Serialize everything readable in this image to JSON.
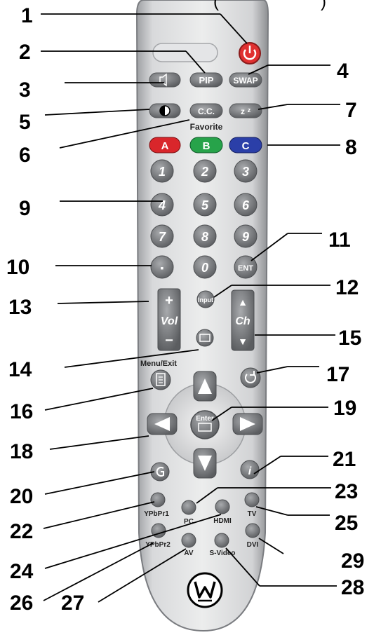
{
  "header_fragment": "(",
  "header_fragment_right": ")",
  "callouts": [
    "1",
    "2",
    "3",
    "4",
    "5",
    "6",
    "7",
    "8",
    "9",
    "10",
    "11",
    "12",
    "13",
    "14",
    "15",
    "16",
    "17",
    "18",
    "19",
    "20",
    "21",
    "22",
    "23",
    "24",
    "25",
    "26",
    "27",
    "28",
    "29"
  ],
  "buttons": {
    "pip": "PIP",
    "swap": "SWAP",
    "cc": "C.C.",
    "sleep": "z",
    "favorite": "Favorite",
    "a": "A",
    "b": "B",
    "c": "C",
    "digits": [
      "1",
      "2",
      "3",
      "4",
      "5",
      "6",
      "7",
      "8",
      "9",
      "0"
    ],
    "dot": "▪",
    "ent": "ENT",
    "input": "Input",
    "vol_plus": "+",
    "vol": "Vol",
    "vol_minus": "−",
    "ch_up": "▲",
    "ch": "Ch",
    "ch_down": "▼",
    "menu_exit": "Menu/Exit",
    "enter": "Enter",
    "ypbpr1": "YPbPr1",
    "pc": "PC",
    "hdmi": "HDMI",
    "tv": "TV",
    "ypbpr2": "YPbPr2",
    "av": "AV",
    "svideo": "S-Video",
    "dvi": "DVI"
  },
  "colors": {
    "remote_body": "#cfd0d2",
    "button_gray": "#7b7d80",
    "power_red": "#e03030",
    "a_red": "#d9262b",
    "b_green": "#27a34a",
    "c_blue": "#2b3fa8"
  }
}
